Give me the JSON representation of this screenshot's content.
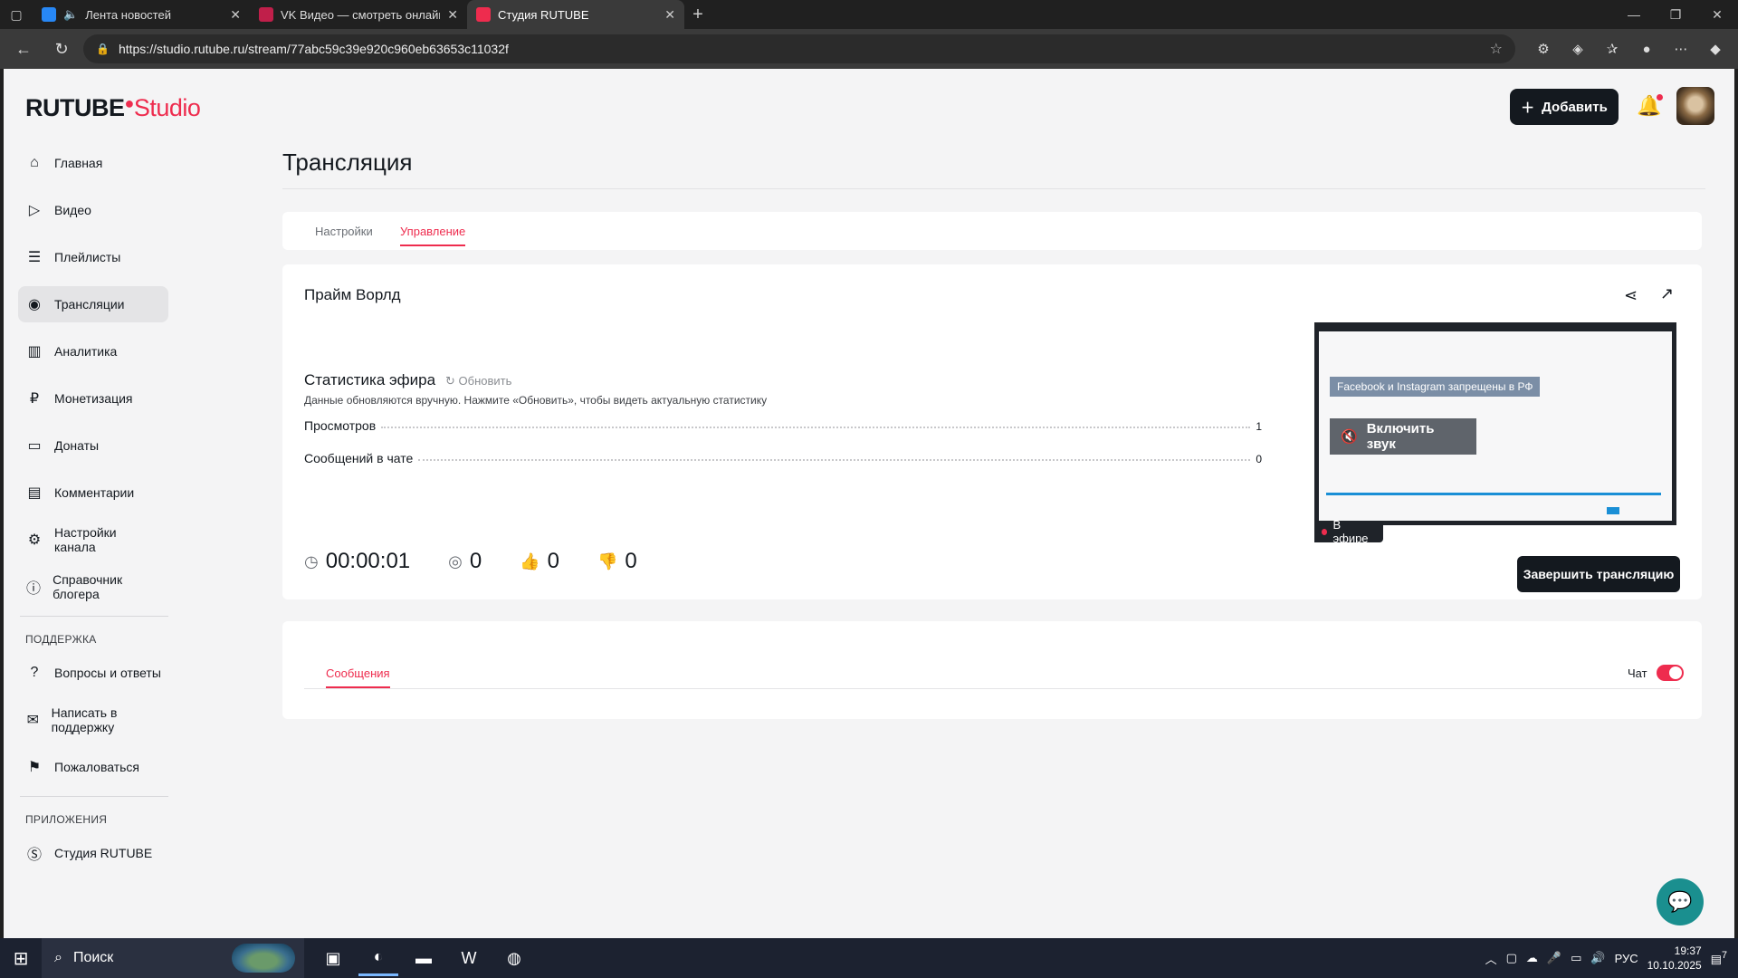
{
  "browser": {
    "tabs": [
      {
        "title": "Лента новостей",
        "favicon_color": "#2787f5",
        "active": false
      },
      {
        "title": "VK Видео — смотреть онлайн бесплатно",
        "favicon_color": "#c01f4a",
        "active": false
      },
      {
        "title": "Студия RUTUBE",
        "favicon_color": "#ee2c4e",
        "active": true
      }
    ],
    "url": "https://studio.rutube.ru/stream/77abc59c39e920c960eb63653c11032f"
  },
  "header": {
    "logo_main": "RUTUBE",
    "logo_accent": "Studio",
    "add_button": "Добавить"
  },
  "sidebar": {
    "items": [
      {
        "label": "Главная",
        "icon": "home-icon"
      },
      {
        "label": "Видео",
        "icon": "video-icon"
      },
      {
        "label": "Плейлисты",
        "icon": "playlist-icon"
      },
      {
        "label": "Трансляции",
        "icon": "broadcast-icon"
      },
      {
        "label": "Аналитика",
        "icon": "analytics-icon"
      },
      {
        "label": "Монетизация",
        "icon": "ruble-icon"
      },
      {
        "label": "Донаты",
        "icon": "wallet-icon"
      },
      {
        "label": "Комментарии",
        "icon": "comment-icon"
      },
      {
        "label": "Настройки канала",
        "icon": "gear-icon"
      },
      {
        "label": "Справочник блогера",
        "icon": "info-icon"
      }
    ],
    "support_caption": "ПОДДЕРЖКА",
    "support_items": [
      {
        "label": "Вопросы и ответы",
        "icon": "question-icon"
      },
      {
        "label": "Написать в поддержку",
        "icon": "mail-icon"
      },
      {
        "label": "Пожаловаться",
        "icon": "flag-icon"
      }
    ],
    "apps_caption": "ПРИЛОЖЕНИЯ",
    "apps_items": [
      {
        "label": "Студия RUTUBE",
        "icon": "studio-icon"
      }
    ]
  },
  "main": {
    "title": "Трансляция",
    "tabs": [
      "Настройки",
      "Управление"
    ],
    "stream_name": "Прайм Ворлд",
    "stats_title": "Статистика эфира",
    "refresh_label": "Обновить",
    "stats_hint": "Данные обновляются вручную. Нажмите «Обновить», чтобы видеть актуальную статистику",
    "stats": [
      {
        "label": "Просмотров",
        "value": "1"
      },
      {
        "label": "Сообщений в чате",
        "value": "0"
      }
    ],
    "counters": {
      "duration": "00:00:01",
      "viewers": "0",
      "likes": "0",
      "dislikes": "0"
    },
    "preview": {
      "badge": "Facebook и Instagram запрещены в РФ",
      "sound_button": "Включить звук",
      "live_label": "В эфире"
    },
    "end_button": "Завершить трансляцию",
    "chat": {
      "tab": "Сообщения",
      "toggle_label": "Чат"
    }
  },
  "taskbar": {
    "search": "Поиск",
    "lang": "РУС",
    "time": "19:37",
    "date": "10.10.2025",
    "notifications": "7"
  },
  "colors": {
    "accent": "#ee2c4e",
    "dark": "#14191f"
  }
}
